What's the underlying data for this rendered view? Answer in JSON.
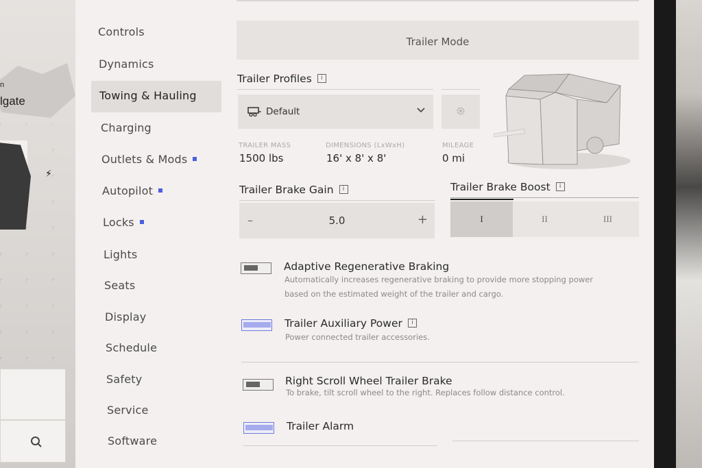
{
  "viewport": {
    "partial_label_1": "n",
    "partial_label_2": "lgate"
  },
  "nav": {
    "items": [
      {
        "label": "Controls",
        "dot": false,
        "active": false
      },
      {
        "label": "Dynamics",
        "dot": false,
        "active": false
      },
      {
        "label": "Towing & Hauling",
        "dot": false,
        "active": true
      },
      {
        "label": "Charging",
        "dot": false,
        "active": false
      },
      {
        "label": "Outlets & Mods",
        "dot": true,
        "active": false
      },
      {
        "label": "Autopilot",
        "dot": true,
        "active": false
      },
      {
        "label": "Locks",
        "dot": true,
        "active": false
      },
      {
        "label": "Lights",
        "dot": false,
        "active": false
      },
      {
        "label": "Seats",
        "dot": false,
        "active": false
      },
      {
        "label": "Display",
        "dot": false,
        "active": false
      },
      {
        "label": "Schedule",
        "dot": false,
        "active": false
      },
      {
        "label": "Safety",
        "dot": false,
        "active": false
      },
      {
        "label": "Service",
        "dot": false,
        "active": false
      },
      {
        "label": "Software",
        "dot": false,
        "active": false
      }
    ],
    "dot_color": "#4b5fe0"
  },
  "main": {
    "trailer_mode_label": "Trailer Mode",
    "profiles": {
      "title": "Trailer Profiles",
      "selected": "Default",
      "icon": "trailer-icon",
      "settings_icon": "gear-icon"
    },
    "stats": [
      {
        "label": "TRAILER MASS",
        "value": "1500 lbs"
      },
      {
        "label": "DIMENSIONS (LxWxH)",
        "value": "16' x 8' x 8'"
      },
      {
        "label": "MILEAGE",
        "value": "0 mi"
      }
    ],
    "brake_gain": {
      "title": "Trailer Brake Gain",
      "value": "5.0",
      "minus": "–",
      "plus": "+"
    },
    "brake_boost": {
      "title": "Trailer Brake Boost",
      "options": [
        "I",
        "II",
        "III"
      ],
      "selected_index": 0
    },
    "options": [
      {
        "title": "Adaptive Regenerative Braking",
        "description_line1": "Automatically increases regenerative braking to provide more stopping power",
        "description_line2": "based on the estimated weight of the trailer and cargo.",
        "on": false
      },
      {
        "title": "Trailer Auxiliary Power",
        "description_line1": "Power connected trailer accessories.",
        "on": true,
        "info": true
      },
      {
        "title": "Right Scroll Wheel Trailer Brake",
        "description_line1": "To brake, tilt scroll wheel to the right. Replaces follow distance control.",
        "on": false
      },
      {
        "title": "Trailer Alarm",
        "on": true
      }
    ],
    "info_glyph": "i"
  },
  "colors": {
    "accent": "#6f7ad9",
    "panel_bg": "#f3f0ef"
  }
}
